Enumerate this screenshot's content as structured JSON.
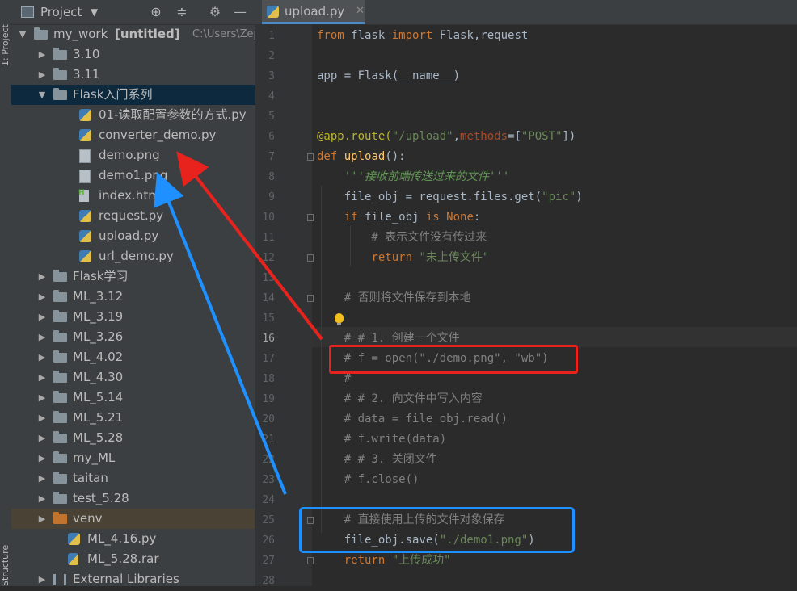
{
  "toolstrip": {
    "project_label": "1: Project",
    "structure_label": "Structure"
  },
  "project_panel": {
    "title": "Project",
    "dropdown_glyph": "▼",
    "buttons": {
      "locate": "⊕",
      "collapse": "≑",
      "settings": "⚙",
      "hide": "—"
    }
  },
  "tree": [
    {
      "arrow": "▼",
      "icon": "folder",
      "label": "my_work",
      "suffix": "[untitled]",
      "path": "C:\\Users\\Zep\\P"
    },
    {
      "arrow": "▶",
      "icon": "folder",
      "label": "3.10"
    },
    {
      "arrow": "▶",
      "icon": "folder",
      "label": "3.11"
    },
    {
      "arrow": "▼",
      "icon": "folder",
      "label": "Flask入门系列",
      "selected": true
    },
    {
      "icon": "python-file",
      "label": "01-读取配置参数的方式.py"
    },
    {
      "icon": "python-file",
      "label": "converter_demo.py"
    },
    {
      "icon": "image-file",
      "label": "demo.png"
    },
    {
      "icon": "image-file",
      "label": "demo1.png"
    },
    {
      "icon": "html-file",
      "label": "index.html"
    },
    {
      "icon": "python-file",
      "label": "request.py"
    },
    {
      "icon": "python-file",
      "label": "upload.py"
    },
    {
      "icon": "python-file",
      "label": "url_demo.py"
    },
    {
      "arrow": "▶",
      "icon": "folder",
      "label": "Flask学习"
    },
    {
      "arrow": "▶",
      "icon": "folder",
      "label": "ML_3.12"
    },
    {
      "arrow": "▶",
      "icon": "folder",
      "label": "ML_3.19"
    },
    {
      "arrow": "▶",
      "icon": "folder",
      "label": "ML_3.26"
    },
    {
      "arrow": "▶",
      "icon": "folder",
      "label": "ML_4.02"
    },
    {
      "arrow": "▶",
      "icon": "folder",
      "label": "ML_4.30"
    },
    {
      "arrow": "▶",
      "icon": "folder",
      "label": "ML_5.14"
    },
    {
      "arrow": "▶",
      "icon": "folder",
      "label": "ML_5.21"
    },
    {
      "arrow": "▶",
      "icon": "folder",
      "label": "ML_5.28"
    },
    {
      "arrow": "▶",
      "icon": "folder",
      "label": "my_ML"
    },
    {
      "arrow": "▶",
      "icon": "folder",
      "label": "taitan"
    },
    {
      "arrow": "▶",
      "icon": "folder",
      "label": "test_5.28"
    },
    {
      "arrow": "▶",
      "icon": "folder-orange",
      "label": "venv",
      "excluded": true
    },
    {
      "icon": "python-file",
      "label": "ML_4.16.py"
    },
    {
      "icon": "rar-file",
      "label": "ML_5.28.rar"
    },
    {
      "arrow": "▶",
      "icon": "library",
      "label": "External Libraries"
    }
  ],
  "editor": {
    "tab_label": "upload.py",
    "tab_close": "✕",
    "current_line": 16,
    "lines": [
      {
        "n": "1"
      },
      {
        "n": "2"
      },
      {
        "n": "3"
      },
      {
        "n": "4"
      },
      {
        "n": "5"
      },
      {
        "n": "6"
      },
      {
        "n": "7"
      },
      {
        "n": "8"
      },
      {
        "n": "9"
      },
      {
        "n": "10"
      },
      {
        "n": "11"
      },
      {
        "n": "12"
      },
      {
        "n": "13"
      },
      {
        "n": "14"
      },
      {
        "n": "15"
      },
      {
        "n": "16"
      },
      {
        "n": "17"
      },
      {
        "n": "18"
      },
      {
        "n": "19"
      },
      {
        "n": "20"
      },
      {
        "n": "21"
      },
      {
        "n": "22"
      },
      {
        "n": "23"
      },
      {
        "n": "24"
      },
      {
        "n": "25"
      },
      {
        "n": "26"
      },
      {
        "n": "27"
      },
      {
        "n": "28"
      }
    ],
    "code": {
      "l1": {
        "from": "from",
        "mod": " flask ",
        "import": "import",
        "rest": " Flask,request"
      },
      "l3": "app = Flask(__name__)",
      "l6": {
        "dec": "@app.route(",
        "s1": "\"/upload\"",
        "comma": ",",
        "param": "methods",
        "eq": "=[",
        "s2": "\"POST\"",
        "end": "])"
      },
      "l7": {
        "def": "def",
        "fn": " upload",
        "rest": "():"
      },
      "l8": "    '''接收前端传送过来的文件'''",
      "l9": {
        "a": "    file_obj = request.files.get(",
        "s": "\"pic\"",
        "b": ")"
      },
      "l10": {
        "ind": "    ",
        "if": "if",
        "a": " file_obj ",
        "is": "is",
        "none": " None",
        "b": ":"
      },
      "l11": "        # 表示文件没有传过来",
      "l12": {
        "ind": "        ",
        "ret": "return",
        "s": " \"未上传文件\""
      },
      "l14": "    # 否则将文件保存到本地",
      "l16": "    # # 1. 创建一个文件",
      "l17": "    # f = open(\"./demo.png\", \"wb\")",
      "l18": "    #",
      "l19": "    # # 2. 向文件中写入内容",
      "l20": "    # data = file_obj.read()",
      "l21": "    # f.write(data)",
      "l22": "    # # 3. 关闭文件",
      "l23": "    # f.close()",
      "l25": "    # 直接使用上传的文件对象保存",
      "l26": {
        "a": "    file_obj.save(",
        "s": "\"./demo1.png\"",
        "b": ")"
      },
      "l27": {
        "ind": "    ",
        "ret": "return",
        "s": " \"上传成功\""
      }
    }
  },
  "annotations": {
    "red_color": "#e8231e",
    "blue_color": "#1e90ff"
  }
}
